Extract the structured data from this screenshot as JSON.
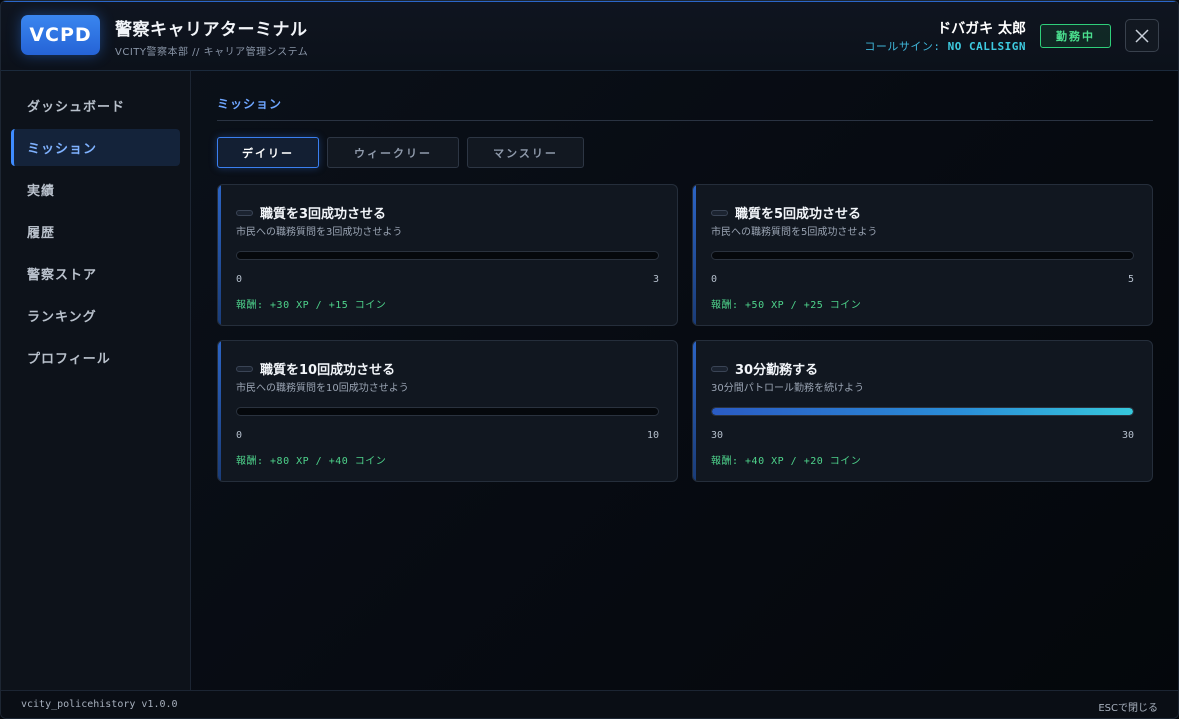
{
  "header": {
    "logo_text": "VCPD",
    "title": "警察キャリアターミナル",
    "subtitle": "VCITY警察本部 // キャリア管理システム",
    "user_name": "ドバガキ 太郎",
    "callsign_label": "コールサイン:",
    "callsign_value": "NO CALLSIGN",
    "status_badge": "勤務中",
    "close_icon": "close-icon"
  },
  "sidebar": {
    "items": [
      {
        "label": "ダッシュボード",
        "active": false
      },
      {
        "label": "ミッション",
        "active": true
      },
      {
        "label": "実績",
        "active": false
      },
      {
        "label": "履歴",
        "active": false
      },
      {
        "label": "警察ストア",
        "active": false
      },
      {
        "label": "ランキング",
        "active": false
      },
      {
        "label": "プロフィール",
        "active": false
      }
    ]
  },
  "main": {
    "section_title": "ミッション",
    "tabs": [
      {
        "label": "デイリー",
        "active": true
      },
      {
        "label": "ウィークリー",
        "active": false
      },
      {
        "label": "マンスリー",
        "active": false
      }
    ],
    "missions": [
      {
        "title": "職質を3回成功させる",
        "description": "市民への職務質問を3回成功させよう",
        "current": "0",
        "target": "3",
        "progress": 0,
        "reward": "報酬: +30 XP / +15 コイン"
      },
      {
        "title": "職質を5回成功させる",
        "description": "市民への職務質問を5回成功させよう",
        "current": "0",
        "target": "5",
        "progress": 0,
        "reward": "報酬: +50 XP / +25 コイン"
      },
      {
        "title": "職質を10回成功させる",
        "description": "市民への職務質問を10回成功させよう",
        "current": "0",
        "target": "10",
        "progress": 0,
        "reward": "報酬: +80 XP / +40 コイン"
      },
      {
        "title": "30分勤務する",
        "description": "30分間パトロール勤務を続けよう",
        "current": "30",
        "target": "30",
        "progress": 1,
        "reward": "報酬: +40 XP / +20 コイン"
      }
    ]
  },
  "footer": {
    "version": "vcity_policehistory v1.0.0",
    "hint": "ESCで閉じる"
  },
  "colors": {
    "accent": "#3f8cff",
    "status_green": "#4be08f",
    "callsign_cyan": "#3ecbe0"
  }
}
